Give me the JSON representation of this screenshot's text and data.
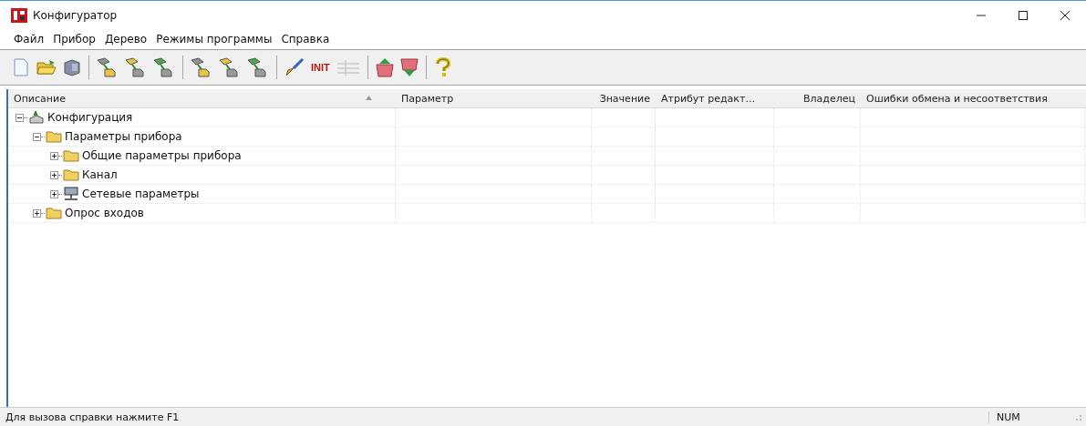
{
  "window": {
    "title": "Конфигуратор"
  },
  "menu": [
    "Файл",
    "Прибор",
    "Дерево",
    "Режимы программы",
    "Справка"
  ],
  "toolbar": [
    [
      {
        "kind": "new"
      },
      {
        "kind": "open"
      },
      {
        "kind": "save"
      }
    ],
    [
      {
        "kind": "read"
      },
      {
        "kind": "write"
      },
      {
        "kind": "compare"
      }
    ],
    [
      {
        "kind": "read"
      },
      {
        "kind": "write"
      },
      {
        "kind": "compare"
      }
    ],
    [
      {
        "kind": "brush"
      },
      {
        "kind": "text",
        "label": "INIT"
      },
      {
        "kind": "grid",
        "disabled": true
      }
    ],
    [
      {
        "kind": "up"
      },
      {
        "kind": "down"
      }
    ],
    [
      {
        "kind": "help"
      }
    ]
  ],
  "table": {
    "columns": [
      {
        "label": "Описание",
        "sorted": true
      },
      {
        "label": "Параметр",
        "sorted": false
      },
      {
        "label": "Значение",
        "sorted": false
      },
      {
        "label": "Атрибут редакт...",
        "sorted": false
      },
      {
        "label": "Владелец",
        "sorted": false
      },
      {
        "label": "Ошибки обмена и несоответствия",
        "sorted": false
      }
    ],
    "tree": [
      {
        "label": "Конфигурация",
        "kind": "config",
        "expanded": true,
        "children": [
          {
            "label": "Параметры прибора",
            "kind": "folder",
            "expanded": true,
            "children": [
              {
                "label": "Общие параметры прибора",
                "kind": "folder",
                "expanded": false
              },
              {
                "label": "Канал",
                "kind": "folder",
                "expanded": false
              },
              {
                "label": "Сетевые параметры",
                "kind": "network",
                "expanded": false
              }
            ]
          },
          {
            "label": "Опрос входов",
            "kind": "folder",
            "expanded": false
          }
        ]
      }
    ]
  },
  "status_bar": {
    "message": "Для вызова справки нажмите F1",
    "indicator": "NUM"
  }
}
